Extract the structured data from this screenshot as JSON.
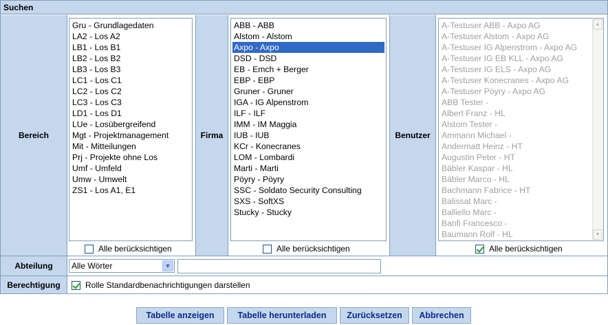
{
  "header": {
    "title": "Suchen"
  },
  "bereich": {
    "label": "Bereich",
    "items": [
      "Gru - Grundlagedaten",
      "LA2 - Los A2",
      "LB1 - Los B1",
      "LB2 - Los B2",
      "LB3 - Los B3",
      "LC1 - Los C1",
      "LC2 - Los C2",
      "LC3 - Los C3",
      "LD1 - Los D1",
      "LUe - Losübergreifend",
      "Mgt - Projektmanagement",
      "Mit - Mitteilungen",
      "Prj - Projekte ohne Los",
      "Umf - Umfeld",
      "Umw - Umwelt",
      "ZS1 - Los A1, E1"
    ],
    "all_label": "Alle berücksichtigen",
    "all_checked": false
  },
  "firma": {
    "label": "Firma",
    "items": [
      "ABB - ABB",
      "Alstom - Alstom",
      "Axpo - Axpo",
      "DSD - DSD",
      "EB - Emch + Berger",
      "EBP - EBP",
      "Gruner - Gruner",
      "IGA - IG Alpenstrom",
      "ILF - ILF",
      "IMM - IM Maggia",
      "IUB - IUB",
      "KCr - Konecranes",
      "LOM - Lombardi",
      "Marti - Marti",
      "Pöyry - Pöyry",
      "SSC - Soldato Security Consulting",
      "SXS - SoftXS",
      "Stucky - Stucky"
    ],
    "selected_index": 2,
    "all_label": "Alle berücksichtigen",
    "all_checked": false
  },
  "benutzer": {
    "label": "Benutzer",
    "items": [
      "A-Testuser ABB - Axpo AG",
      "A-Testuser Alstom - Axpo AG",
      "A-Testuser IG Alpenstrom - Axpo AG",
      "A-Testuser IG EB KLL - Axpo AG",
      "A-Testuser IG ELS - Axpo AG",
      "A-Testuser Konecranes - Axpo AG",
      "A-Testuser Pöyry - Axpo AG",
      "ABB Tester -",
      "Albert Franz - HL",
      "Alstom Tester -",
      "Ammann Michael -",
      "Andermatt Heinz - HT",
      "Augustin Peter - HT",
      "Bäbler Kaspar - HL",
      "Bäbler Marco - HL",
      "Bachmann Fabrice - HT",
      "Balissat Marc -",
      "Balliello Marc -",
      "Banfi Francesco -",
      "Baumann Rolf - HL"
    ],
    "all_label": "Alle berücksichtigen",
    "all_checked": true
  },
  "abteilung": {
    "label": "Abteilung",
    "select_value": "Alle Wörter",
    "text_value": ""
  },
  "berechtigung": {
    "label": "Berechtigung",
    "checkbox_label": "Rolle Standardbenachrichtigungen darstellen",
    "checked": true
  },
  "buttons": {
    "show_table": "Tabelle anzeigen",
    "download_table": "Tabelle herunterladen",
    "reset": "Zurücksetzen",
    "cancel": "Abbrechen"
  },
  "icons": {
    "scroll_up": "▲",
    "scroll_down": "▼",
    "dropdown": "▼"
  },
  "colors": {
    "label_bg": "#c5d7ed",
    "border": "#7f9db9",
    "selection": "#316ac5",
    "button_text": "#0b2b8c"
  }
}
